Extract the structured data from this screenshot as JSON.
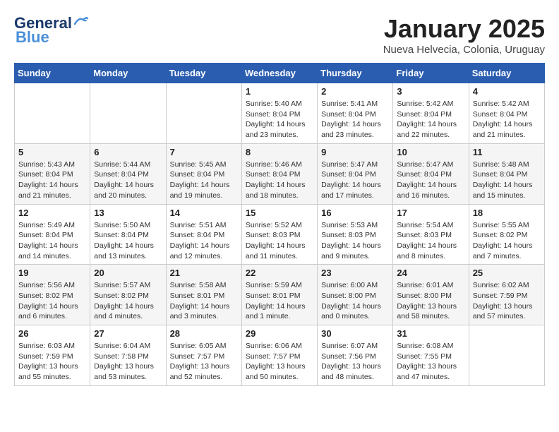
{
  "header": {
    "logo_general": "General",
    "logo_blue": "Blue",
    "month_title": "January 2025",
    "subtitle": "Nueva Helvecia, Colonia, Uruguay"
  },
  "days_of_week": [
    "Sunday",
    "Monday",
    "Tuesday",
    "Wednesday",
    "Thursday",
    "Friday",
    "Saturday"
  ],
  "weeks": [
    [
      {
        "day": "",
        "info": ""
      },
      {
        "day": "",
        "info": ""
      },
      {
        "day": "",
        "info": ""
      },
      {
        "day": "1",
        "info": "Sunrise: 5:40 AM\nSunset: 8:04 PM\nDaylight: 14 hours\nand 23 minutes."
      },
      {
        "day": "2",
        "info": "Sunrise: 5:41 AM\nSunset: 8:04 PM\nDaylight: 14 hours\nand 23 minutes."
      },
      {
        "day": "3",
        "info": "Sunrise: 5:42 AM\nSunset: 8:04 PM\nDaylight: 14 hours\nand 22 minutes."
      },
      {
        "day": "4",
        "info": "Sunrise: 5:42 AM\nSunset: 8:04 PM\nDaylight: 14 hours\nand 21 minutes."
      }
    ],
    [
      {
        "day": "5",
        "info": "Sunrise: 5:43 AM\nSunset: 8:04 PM\nDaylight: 14 hours\nand 21 minutes."
      },
      {
        "day": "6",
        "info": "Sunrise: 5:44 AM\nSunset: 8:04 PM\nDaylight: 14 hours\nand 20 minutes."
      },
      {
        "day": "7",
        "info": "Sunrise: 5:45 AM\nSunset: 8:04 PM\nDaylight: 14 hours\nand 19 minutes."
      },
      {
        "day": "8",
        "info": "Sunrise: 5:46 AM\nSunset: 8:04 PM\nDaylight: 14 hours\nand 18 minutes."
      },
      {
        "day": "9",
        "info": "Sunrise: 5:47 AM\nSunset: 8:04 PM\nDaylight: 14 hours\nand 17 minutes."
      },
      {
        "day": "10",
        "info": "Sunrise: 5:47 AM\nSunset: 8:04 PM\nDaylight: 14 hours\nand 16 minutes."
      },
      {
        "day": "11",
        "info": "Sunrise: 5:48 AM\nSunset: 8:04 PM\nDaylight: 14 hours\nand 15 minutes."
      }
    ],
    [
      {
        "day": "12",
        "info": "Sunrise: 5:49 AM\nSunset: 8:04 PM\nDaylight: 14 hours\nand 14 minutes."
      },
      {
        "day": "13",
        "info": "Sunrise: 5:50 AM\nSunset: 8:04 PM\nDaylight: 14 hours\nand 13 minutes."
      },
      {
        "day": "14",
        "info": "Sunrise: 5:51 AM\nSunset: 8:04 PM\nDaylight: 14 hours\nand 12 minutes."
      },
      {
        "day": "15",
        "info": "Sunrise: 5:52 AM\nSunset: 8:03 PM\nDaylight: 14 hours\nand 11 minutes."
      },
      {
        "day": "16",
        "info": "Sunrise: 5:53 AM\nSunset: 8:03 PM\nDaylight: 14 hours\nand 9 minutes."
      },
      {
        "day": "17",
        "info": "Sunrise: 5:54 AM\nSunset: 8:03 PM\nDaylight: 14 hours\nand 8 minutes."
      },
      {
        "day": "18",
        "info": "Sunrise: 5:55 AM\nSunset: 8:02 PM\nDaylight: 14 hours\nand 7 minutes."
      }
    ],
    [
      {
        "day": "19",
        "info": "Sunrise: 5:56 AM\nSunset: 8:02 PM\nDaylight: 14 hours\nand 6 minutes."
      },
      {
        "day": "20",
        "info": "Sunrise: 5:57 AM\nSunset: 8:02 PM\nDaylight: 14 hours\nand 4 minutes."
      },
      {
        "day": "21",
        "info": "Sunrise: 5:58 AM\nSunset: 8:01 PM\nDaylight: 14 hours\nand 3 minutes."
      },
      {
        "day": "22",
        "info": "Sunrise: 5:59 AM\nSunset: 8:01 PM\nDaylight: 14 hours\nand 1 minute."
      },
      {
        "day": "23",
        "info": "Sunrise: 6:00 AM\nSunset: 8:00 PM\nDaylight: 14 hours\nand 0 minutes."
      },
      {
        "day": "24",
        "info": "Sunrise: 6:01 AM\nSunset: 8:00 PM\nDaylight: 13 hours\nand 58 minutes."
      },
      {
        "day": "25",
        "info": "Sunrise: 6:02 AM\nSunset: 7:59 PM\nDaylight: 13 hours\nand 57 minutes."
      }
    ],
    [
      {
        "day": "26",
        "info": "Sunrise: 6:03 AM\nSunset: 7:59 PM\nDaylight: 13 hours\nand 55 minutes."
      },
      {
        "day": "27",
        "info": "Sunrise: 6:04 AM\nSunset: 7:58 PM\nDaylight: 13 hours\nand 53 minutes."
      },
      {
        "day": "28",
        "info": "Sunrise: 6:05 AM\nSunset: 7:57 PM\nDaylight: 13 hours\nand 52 minutes."
      },
      {
        "day": "29",
        "info": "Sunrise: 6:06 AM\nSunset: 7:57 PM\nDaylight: 13 hours\nand 50 minutes."
      },
      {
        "day": "30",
        "info": "Sunrise: 6:07 AM\nSunset: 7:56 PM\nDaylight: 13 hours\nand 48 minutes."
      },
      {
        "day": "31",
        "info": "Sunrise: 6:08 AM\nSunset: 7:55 PM\nDaylight: 13 hours\nand 47 minutes."
      },
      {
        "day": "",
        "info": ""
      }
    ]
  ]
}
